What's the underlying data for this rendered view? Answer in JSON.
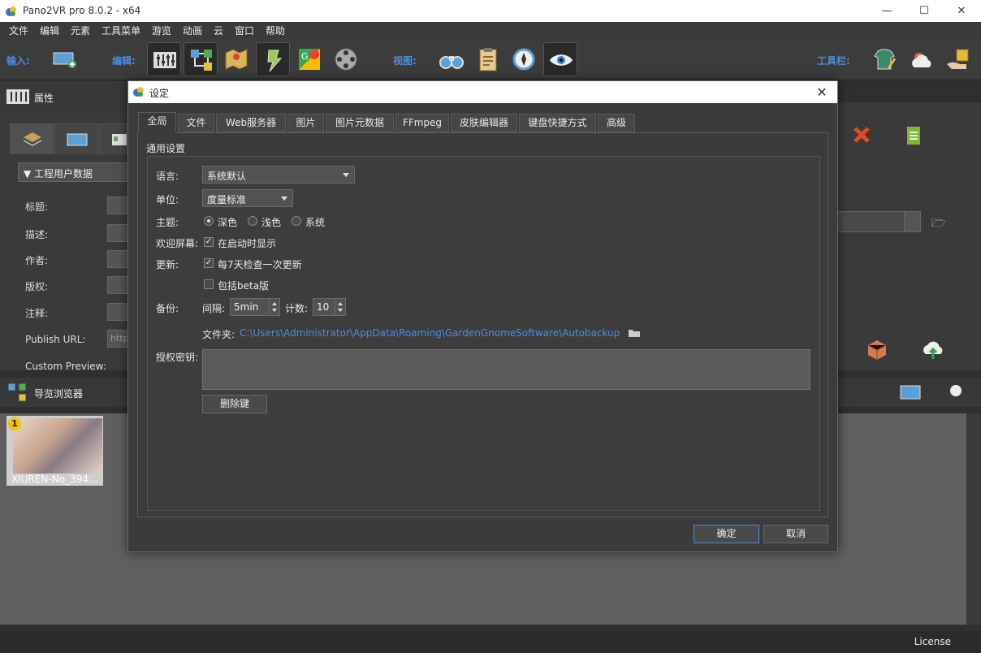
{
  "app": {
    "title": "Pano2VR pro 8.0.2 - x64",
    "min": "—",
    "max": "☐",
    "close": "✕"
  },
  "menu": [
    "文件",
    "编辑",
    "元素",
    "工具菜单",
    "游览",
    "动画",
    "云",
    "窗口",
    "帮助"
  ],
  "toolbar": {
    "input_label": "输入:",
    "edit_label": "编辑:",
    "view_label": "视图:",
    "tools_label": "工具栏:"
  },
  "props": {
    "title": "属性",
    "group": "工程用户数据",
    "fields": [
      "标题:",
      "描述:",
      "作者:",
      "版权:",
      "注释:",
      "Publish URL:",
      "Custom Preview:"
    ],
    "url_placeholder": "http"
  },
  "browser": {
    "title": "导览浏览器",
    "thumb_badge": "1",
    "thumb_caption": "XIUREN-No_394..."
  },
  "status": {
    "license": "License"
  },
  "dialog": {
    "title": "设定",
    "close": "✕",
    "tabs": [
      "全局",
      "文件",
      "Web服务器",
      "图片",
      "图片元数据",
      "FFmpeg",
      "皮肤编辑器",
      "键盘快捷方式",
      "高级"
    ],
    "section": "通用设置",
    "language": {
      "label": "语言:",
      "value": "系统默认"
    },
    "unit": {
      "label": "单位:",
      "value": "度量标准"
    },
    "theme": {
      "label": "主题:",
      "options": [
        "深色",
        "浅色",
        "系统"
      ],
      "selected": "深色"
    },
    "welcome": {
      "label": "欢迎屏幕:",
      "check": "在启动时显示",
      "checked": true
    },
    "update": {
      "label": "更新:",
      "check1": "每7天检查一次更新",
      "check1_on": true,
      "check2": "包括beta版",
      "check2_on": false
    },
    "backup": {
      "label": "备份:",
      "interval_label": "间隔:",
      "interval": "5min",
      "count_label": "计数:",
      "count": "10",
      "folder_label": "文件夹:",
      "folder": "C:\\Users\\Administrator\\AppData\\Roaming\\GardenGnomeSoftware\\Autobackup"
    },
    "license": {
      "label": "授权密钥:",
      "delete": "删除键"
    },
    "ok": "确定",
    "cancel": "取消"
  }
}
